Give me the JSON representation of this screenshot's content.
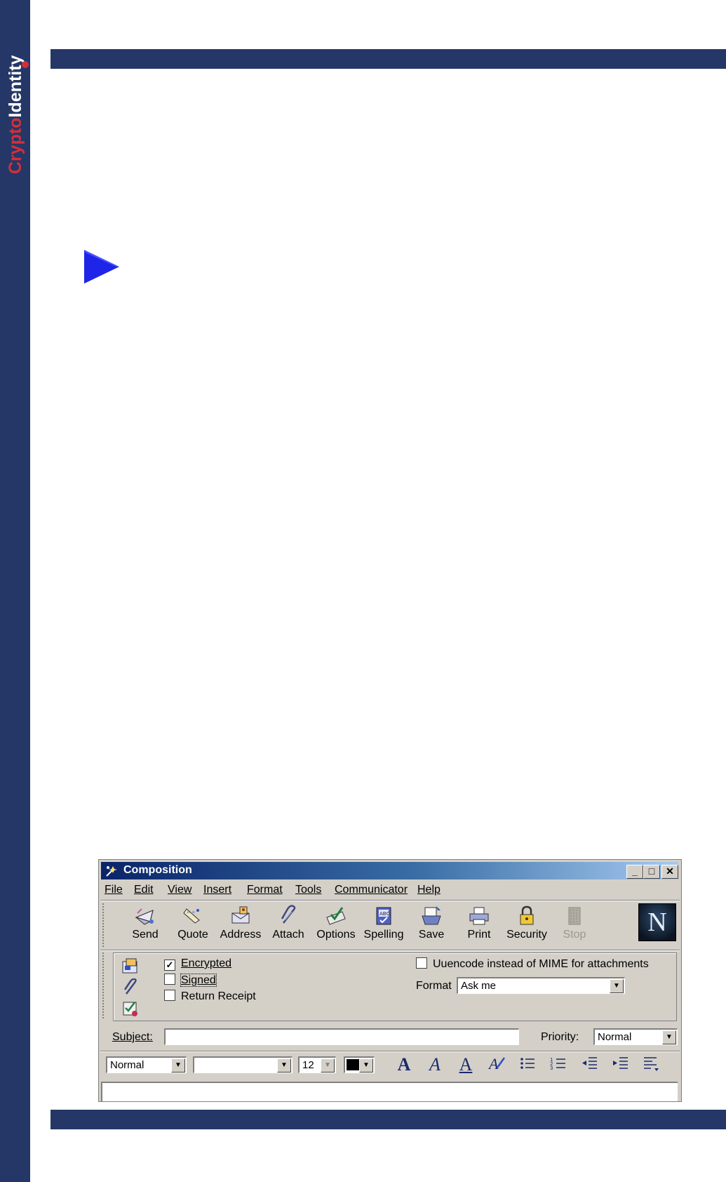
{
  "branding": {
    "logo_text": "CryptoIdentity",
    "colors": {
      "navy": "#253766",
      "logo_red": "#d32f3a"
    }
  },
  "window": {
    "title": "Composition",
    "title_icon": "composition-icon",
    "controls": {
      "minimize": "_",
      "maximize": "□",
      "close": "✕"
    }
  },
  "menu": [
    "File",
    "Edit",
    "View",
    "Insert",
    "Format",
    "Tools",
    "Communicator",
    "Help"
  ],
  "toolbar": [
    {
      "label": "Send",
      "icon": "send-icon"
    },
    {
      "label": "Quote",
      "icon": "quote-icon"
    },
    {
      "label": "Address",
      "icon": "address-icon"
    },
    {
      "label": "Attach",
      "icon": "attach-icon"
    },
    {
      "label": "Options",
      "icon": "options-icon"
    },
    {
      "label": "Spelling",
      "icon": "spelling-icon"
    },
    {
      "label": "Save",
      "icon": "save-icon"
    },
    {
      "label": "Print",
      "icon": "print-icon"
    },
    {
      "label": "Security",
      "icon": "security-icon"
    },
    {
      "label": "Stop",
      "icon": "stop-icon"
    }
  ],
  "netscape_logo": "N",
  "options": {
    "encrypted": {
      "label": "Encrypted",
      "checked": true
    },
    "signed": {
      "label": "Signed",
      "checked": false
    },
    "return_receipt": {
      "label": "Return Receipt",
      "checked": false
    },
    "uuencode": {
      "label": "Uuencode instead of MIME for attachments",
      "checked": false
    },
    "format_label": "Format",
    "format_value": "Ask me"
  },
  "subject": {
    "label": "Subject:",
    "value": ""
  },
  "priority": {
    "label": "Priority:",
    "value": "Normal"
  },
  "formatting": {
    "paragraph_style": "Normal",
    "font": "",
    "size": "12",
    "color": "#000000"
  }
}
